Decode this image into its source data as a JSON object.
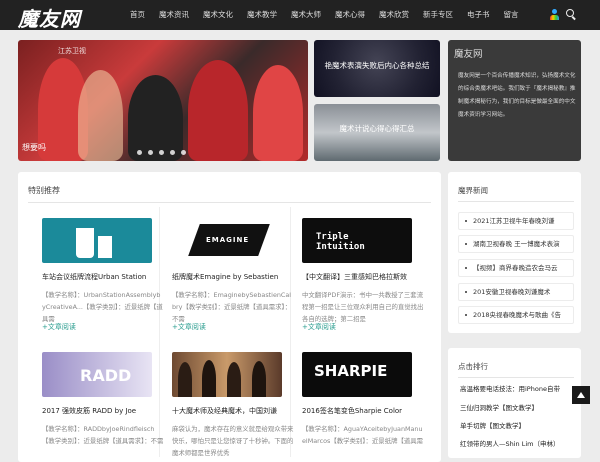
{
  "header": {
    "logo": "魔友网",
    "nav": [
      "首页",
      "魔术资讯",
      "魔术文化",
      "魔术教学",
      "魔术大师",
      "魔术心得",
      "魔术欣赏",
      "新手专区",
      "电子书",
      "留言"
    ]
  },
  "slider": {
    "tag": "江苏卫视",
    "caption": "想要吗"
  },
  "featured": [
    {
      "title": "艳魔术表演失败后内心各种总结"
    },
    {
      "title": "魔术计说心得心得汇总"
    }
  ],
  "about": {
    "title": "魔友网",
    "text": "魔友网是一个百合传播魔术知识，弘扬魔术文化的综合类魔术吧站。我们致于『魔术揭秘教』推制魔术揭秘行为，我们的目标是做最全面的中文魔术资讯学习网站。"
  },
  "content": {
    "title": "特别推荐",
    "more_label": "+文章阅读",
    "cards": [
      {
        "title": "车站会议纸牌流程Urban Station",
        "desc": "【教学名称】：UrbanStationAssemblybyCreativeA...【教学类别】：近景纸牌【道具需",
        "thumb_text": ""
      },
      {
        "title": "纸牌魔术Emagine by Sebastien",
        "desc": "【教学名称】：EmaginebySebastienCalbry【教学类别】：近景纸牌【道具需求】：不需",
        "thumb_text": "EMAGINE"
      },
      {
        "title": "【中文翻译】三重感知巴格拉斯效",
        "desc": "中文翻译PDF演示：书中一共教授了三套流程第一招是让三位观众利用自己的直觉找出各自的选牌；第二招是",
        "thumb_text": "Triple Intuition"
      },
      {
        "title": "2017 强效皮筋 RADD by Joe",
        "desc": "【教学名称】：RADDbyJoeRindfleisch【教学类别】：近景纸牌【道具需求】：不需",
        "thumb_text": "RADD"
      },
      {
        "title": "十大魔术师及经典魔术，中国刘谦",
        "desc": "麻袋认为，魔术存在的意义就是给观众带来快乐，哪怕只是让您惊讶了十秒钟。下面的魔术师都是世界优秀",
        "thumb_text": ""
      },
      {
        "title": "2016签名笔变色Sharpie Color",
        "desc": "【教学名称】：AguaYAceitebyJuanManuelMarcos【教学类别】：近景纸牌【道具需",
        "thumb_text": "SHARPIE"
      }
    ]
  },
  "news": {
    "title": "魔界新闻",
    "items": [
      "2021江苏卫视牛年春晚刘谦",
      "湖南卫视春晚 王一博魔术表演",
      "【视频】商界春晚造农会马云",
      "201安徽卫视春晚刘谦魔术",
      "2018央视春晚魔术与歌曲《告"
    ]
  },
  "rank": {
    "title": "点击排行",
    "items": [
      "高温格要电话技法：用iPhone自带",
      "三仙归洞教学【图文教学】",
      "单手切牌【图文教学】",
      "红领带的男人—Shin Lim（申林）"
    ]
  },
  "colors": {
    "header_bg": "#222222",
    "accent": "#2a9d8f"
  }
}
